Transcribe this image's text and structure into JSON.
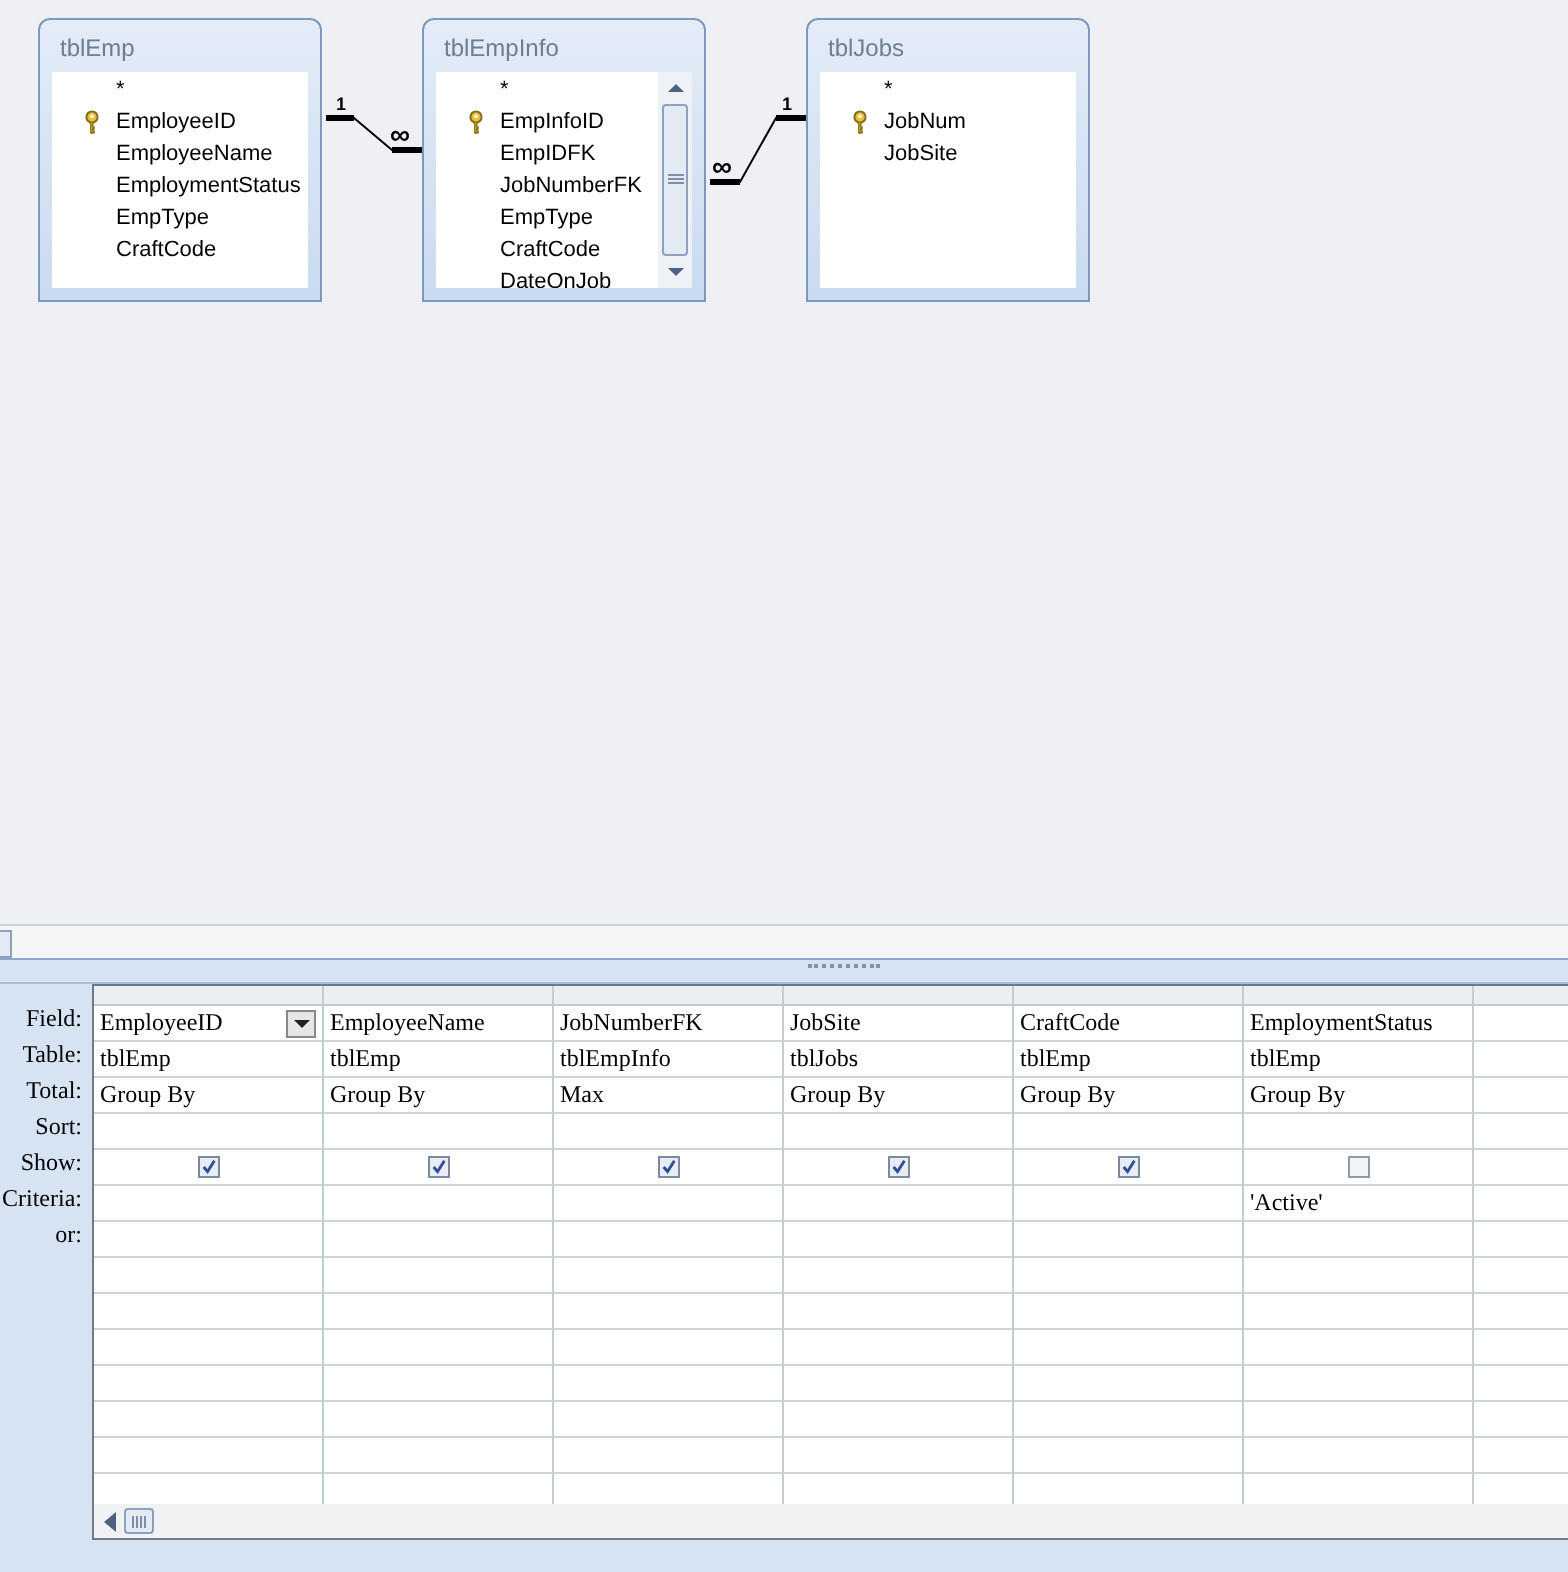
{
  "tables": [
    {
      "name": "tblEmp",
      "fields": [
        {
          "name": "*",
          "key": false
        },
        {
          "name": "EmployeeID",
          "key": true
        },
        {
          "name": "EmployeeName",
          "key": false
        },
        {
          "name": "EmploymentStatus",
          "key": false
        },
        {
          "name": "EmpType",
          "key": false
        },
        {
          "name": "CraftCode",
          "key": false
        }
      ]
    },
    {
      "name": "tblEmpInfo",
      "scrollbar": true,
      "fields": [
        {
          "name": "*",
          "key": false
        },
        {
          "name": "EmpInfoID",
          "key": true
        },
        {
          "name": "EmpIDFK",
          "key": false
        },
        {
          "name": "JobNumberFK",
          "key": false
        },
        {
          "name": "EmpType",
          "key": false
        },
        {
          "name": "CraftCode",
          "key": false
        },
        {
          "name": "DateOnJob",
          "key": false
        }
      ]
    },
    {
      "name": "tblJobs",
      "fields": [
        {
          "name": "*",
          "key": false
        },
        {
          "name": "JobNum",
          "key": true
        },
        {
          "name": "JobSite",
          "key": false
        }
      ]
    }
  ],
  "relationships": [
    {
      "from_label": "1",
      "to_label": "∞"
    },
    {
      "from_label": "∞",
      "to_label": "1"
    }
  ],
  "row_labels": [
    "Field:",
    "Table:",
    "Total:",
    "Sort:",
    "Show:",
    "Criteria:",
    "or:"
  ],
  "columns": [
    {
      "field": "EmployeeID",
      "table": "tblEmp",
      "total": "Group By",
      "show": true,
      "focused": true
    },
    {
      "field": "EmployeeName",
      "table": "tblEmp",
      "total": "Group By",
      "show": true,
      "focused": false
    },
    {
      "field": "JobNumberFK",
      "table": "tblEmpInfo",
      "total": "Max",
      "show": true,
      "focused": false
    },
    {
      "field": "JobSite",
      "table": "tblJobs",
      "total": "Group By",
      "show": true,
      "focused": false
    },
    {
      "field": "CraftCode",
      "table": "tblEmp",
      "total": "Group By",
      "show": true,
      "focused": false
    },
    {
      "field": "EmploymentStatus",
      "table": "tblEmp",
      "total": "Group By",
      "show": false,
      "criteria": "'Active'",
      "focused": false
    }
  ]
}
